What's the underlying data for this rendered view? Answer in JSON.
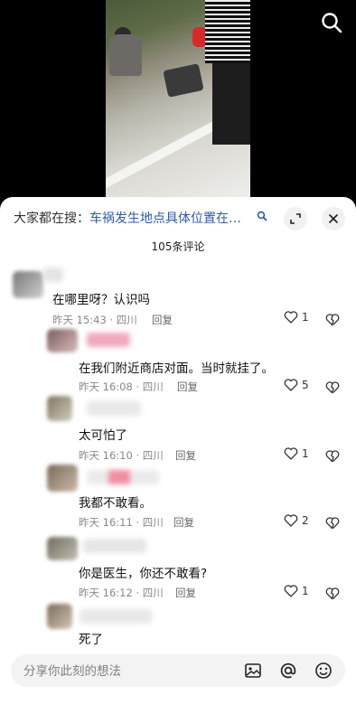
{
  "video": {
    "search_icon": "search-icon"
  },
  "hot_search": {
    "prefix": "大家都在搜：",
    "query": "车祸发生地点具体位置在…",
    "search_icon": "search-icon",
    "expand_icon": "expand-icon",
    "close_icon": "close-icon"
  },
  "comments_count": "105条评论",
  "comments": [
    {
      "text": "在哪里呀？认识吗",
      "time": "昨天 15:43 · 四川",
      "reply": "回复",
      "likes": "1"
    },
    {
      "text": "在我们附近商店对面。当时就挂了。",
      "time": "昨天 16:08 · 四川",
      "reply": "回复",
      "likes": "5"
    },
    {
      "text": "太可怕了",
      "time": "昨天 16:10 · 四川",
      "reply": "回复",
      "likes": "1"
    },
    {
      "text": "我都不敢看。",
      "time": "昨天 16:11 · 四川",
      "reply": "回复",
      "likes": "2"
    },
    {
      "text": "你是医生，你还不敢看?",
      "time": "昨天 16:12 · 四川",
      "reply": "回复",
      "likes": "1"
    },
    {
      "text": "死了"
    }
  ],
  "input": {
    "placeholder": "分享你此刻的想法"
  },
  "input_icons": [
    "image-icon",
    "at-icon",
    "emoji-icon"
  ],
  "colors": {
    "link": "#2f5aa8",
    "meta": "#888888",
    "input_bg": "#f3f3f3"
  }
}
